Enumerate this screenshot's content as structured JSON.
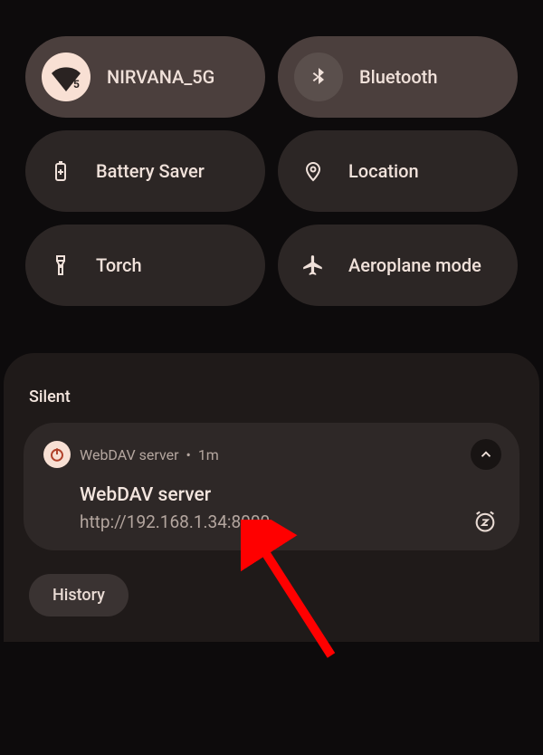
{
  "qs": {
    "tiles": [
      {
        "label": "NIRVANA_5G",
        "icon": "wifi",
        "active": true,
        "wifi": true
      },
      {
        "label": "Bluetooth",
        "icon": "bluetooth",
        "active": true,
        "wifi": false
      },
      {
        "label": "Battery Saver",
        "icon": "battery",
        "active": false,
        "wifi": false
      },
      {
        "label": "Location",
        "icon": "location",
        "active": false,
        "wifi": false
      },
      {
        "label": "Torch",
        "icon": "torch",
        "active": false,
        "wifi": false
      },
      {
        "label": "Aeroplane mode",
        "icon": "airplane",
        "active": false,
        "wifi": false
      }
    ]
  },
  "notifications": {
    "section_label": "Silent",
    "card": {
      "app": "WebDAV server",
      "time": "1m",
      "title": "WebDAV server",
      "text": "http://192.168.1.34:8000"
    },
    "history_label": "History"
  },
  "colors": {
    "accent": "#f8e0d4",
    "tile_active": "#4b3f3d",
    "tile_inactive": "#2c2625",
    "arrow": "#ff0000"
  }
}
